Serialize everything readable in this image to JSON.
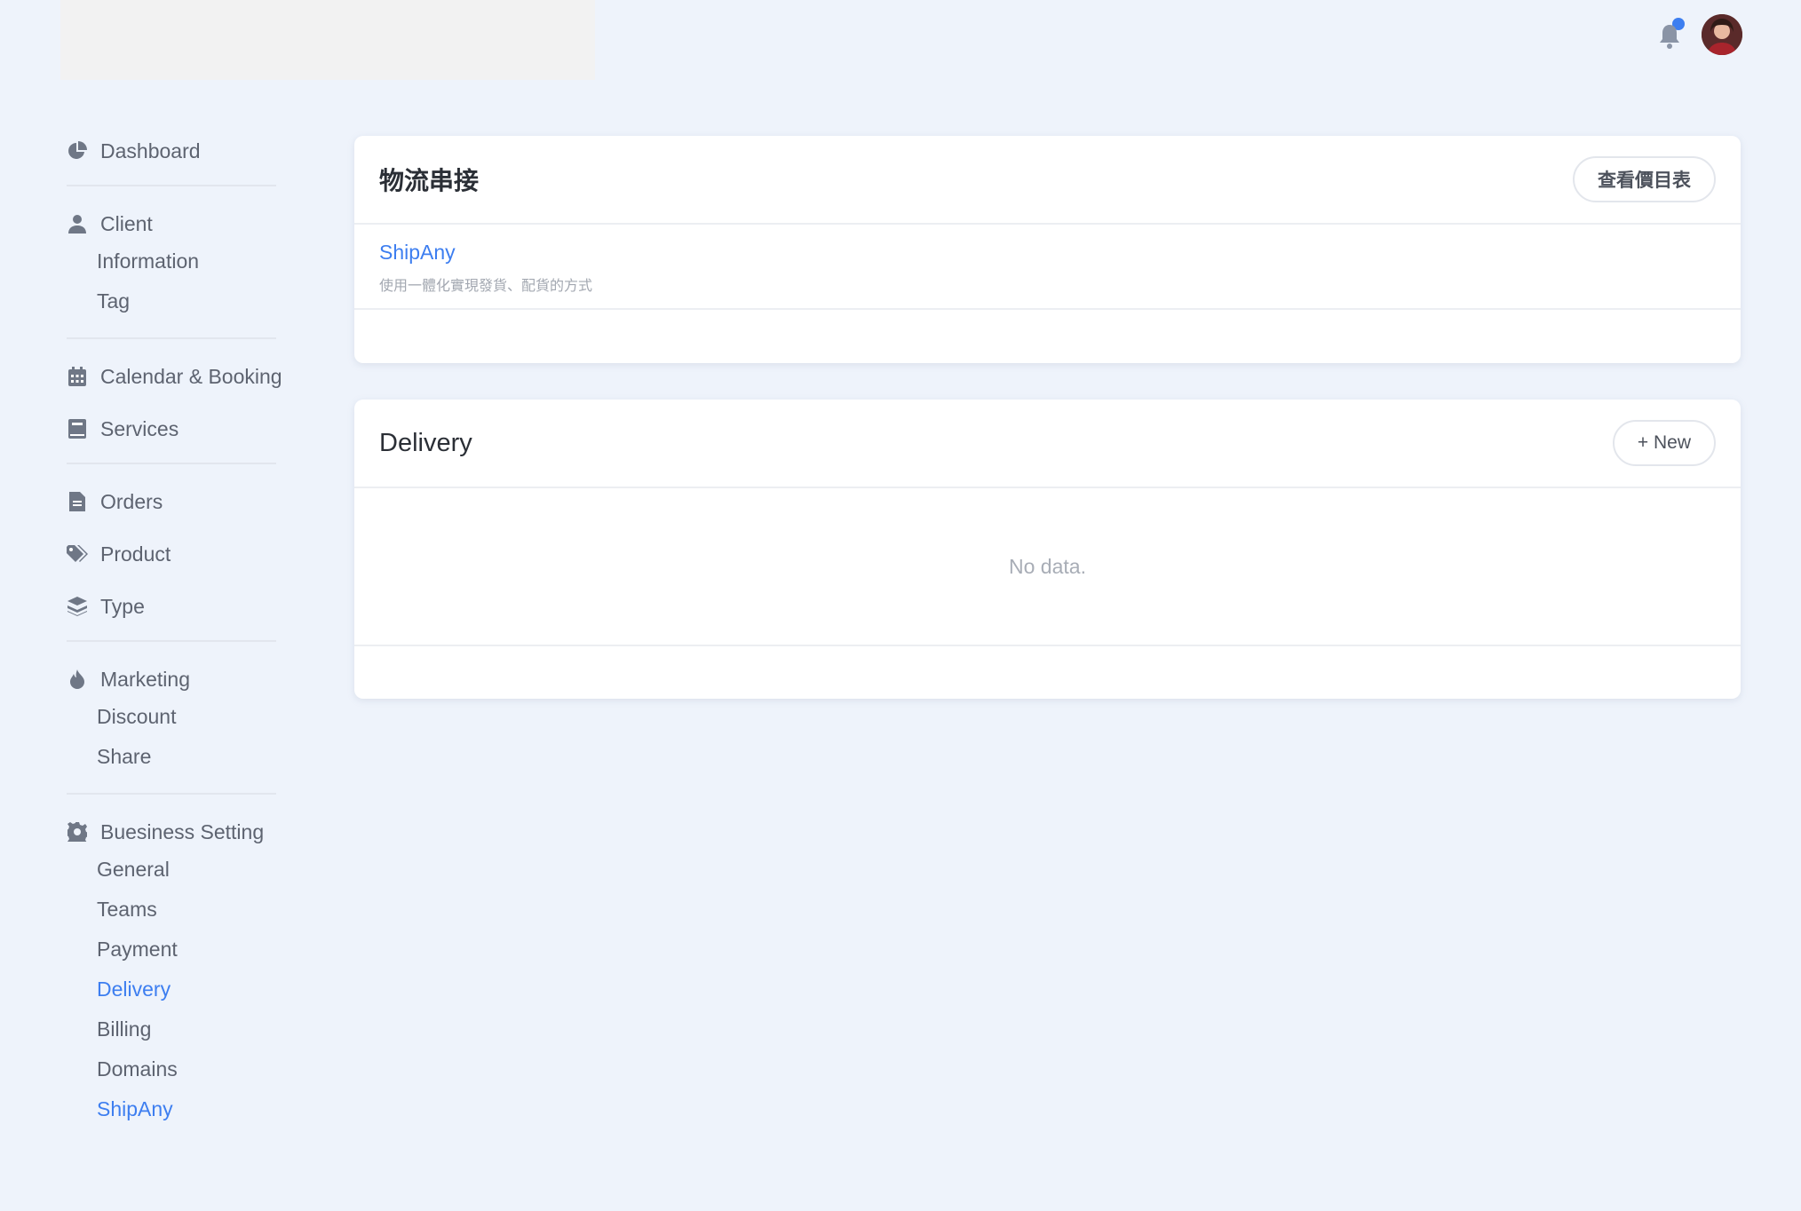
{
  "sidebar": {
    "dashboard": "Dashboard",
    "client": "Client",
    "client_items": [
      "Information",
      "Tag"
    ],
    "calendar": "Calendar & Booking",
    "services": "Services",
    "orders": "Orders",
    "product": "Product",
    "type": "Type",
    "marketing": "Marketing",
    "marketing_items": [
      "Discount",
      "Share"
    ],
    "business": "Buesiness Setting",
    "business_items": [
      "General",
      "Teams",
      "Payment",
      "Delivery",
      "Billing",
      "Domains",
      "ShipAny"
    ]
  },
  "logistics": {
    "title": "物流串接",
    "price_button": "查看價目表",
    "item_title": "ShipAny",
    "item_desc": "使用一體化實現發貨、配貨的方式"
  },
  "delivery": {
    "title": "Delivery",
    "new_button": "+ New",
    "empty_text": "No data."
  },
  "colors": {
    "accent": "#3d7ef0",
    "background": "#eef3fb",
    "text": "#5d6370"
  },
  "icons": {
    "dashboard": "pie-chart-icon",
    "client": "user-icon",
    "calendar": "calendar-icon",
    "services": "book-icon",
    "orders": "file-icon",
    "product": "tags-icon",
    "type": "layers-icon",
    "marketing": "fire-icon",
    "business": "gear-icon",
    "notification": "bell-icon"
  }
}
